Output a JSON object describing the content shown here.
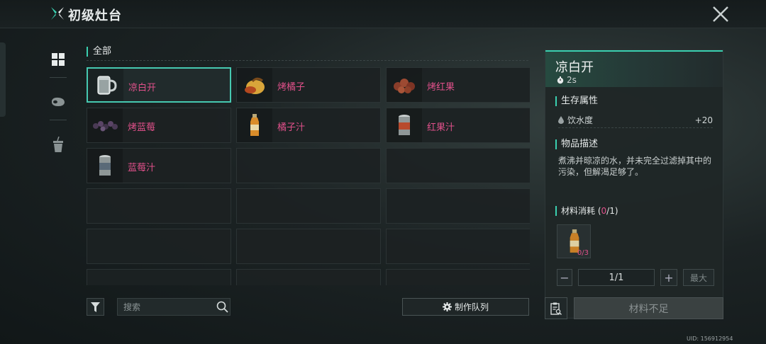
{
  "header": {
    "title": "初级灶台",
    "logo_icon": "star-emblem-icon",
    "close_icon": "close-icon"
  },
  "sidebar": {
    "items": [
      {
        "icon": "grid-icon",
        "active": true
      },
      {
        "icon": "meat-icon",
        "active": false
      },
      {
        "icon": "drink-cup-icon",
        "active": false
      }
    ]
  },
  "category": {
    "label": "全部"
  },
  "recipes": [
    {
      "name": "凉白开",
      "icon": "water-mug-icon",
      "selected": true
    },
    {
      "name": "烤橘子",
      "icon": "roasted-orange-icon"
    },
    {
      "name": "烤红果",
      "icon": "roasted-redfruit-icon"
    },
    {
      "name": "烤蓝莓",
      "icon": "roasted-blueberry-icon"
    },
    {
      "name": "橘子汁",
      "icon": "orange-juice-bottle-icon"
    },
    {
      "name": "红果汁",
      "icon": "redfruit-juice-can-icon"
    },
    {
      "name": "蓝莓汁",
      "icon": "blueberry-juice-can-icon"
    },
    {
      "name": ""
    },
    {
      "name": ""
    },
    {
      "name": ""
    },
    {
      "name": ""
    },
    {
      "name": ""
    },
    {
      "name": ""
    },
    {
      "name": ""
    },
    {
      "name": ""
    },
    {
      "name": ""
    },
    {
      "name": ""
    },
    {
      "name": ""
    }
  ],
  "toolbar": {
    "search_placeholder": "搜索",
    "queue_label": "制作队列"
  },
  "detail": {
    "title": "凉白开",
    "time": "2s",
    "survival_title": "生存属性",
    "attribute": {
      "label": "饮水度",
      "value": "+20"
    },
    "desc_title": "物品描述",
    "description": "煮沸并晾凉的水，并未完全过滤掉其中的污染，但解渴足够了。",
    "materials": {
      "label": "材料消耗",
      "have": "0",
      "need": "/1",
      "item_count": "0/3"
    },
    "quantity": {
      "minus": "−",
      "value": "1/1",
      "plus": "+",
      "max": "最大"
    },
    "craft_label": "材料不足"
  },
  "uid": "UID: 156912954",
  "colors": {
    "accent": "#3ad0b0",
    "recipe_text": "#e0508a",
    "panel_bg": "#1f2627"
  }
}
